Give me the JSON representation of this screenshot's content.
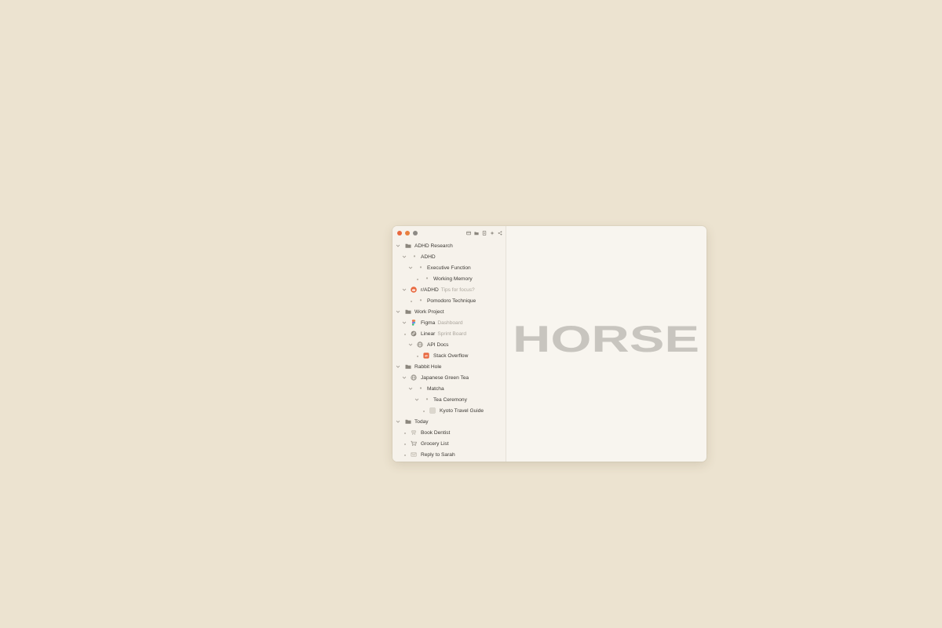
{
  "brand": {
    "wordmark": "HORSE"
  },
  "colors": {
    "background": "#ece3d0",
    "window": "#f8f5ef",
    "accent": "#e8683f",
    "wordmark": "#c8c5bf"
  },
  "toolbar": {
    "buttons": [
      "tab-icon",
      "folder-icon",
      "document-icon",
      "sparkle-icon",
      "share-icon"
    ]
  },
  "tree": {
    "r0": {
      "label": "ADHD Research",
      "icon": "folder-icon"
    },
    "r1": {
      "label": "ADHD",
      "icon": "note-icon"
    },
    "r2": {
      "label": "Executive Function",
      "icon": "note-icon"
    },
    "r3": {
      "label": "Working Memory",
      "icon": "note-icon"
    },
    "r4": {
      "label": "r/ADHD",
      "sub": "Tips for focus?",
      "icon": "reddit-icon"
    },
    "r5": {
      "label": "Pomodoro Technique",
      "icon": "note-icon"
    },
    "r6": {
      "label": "Work Project",
      "icon": "folder-icon"
    },
    "r7": {
      "label": "Figma",
      "sub": "Dashboard",
      "icon": "figma-icon"
    },
    "r8": {
      "label": "Linear",
      "sub": "Sprint Board",
      "icon": "linear-icon"
    },
    "r9": {
      "label": "API Docs",
      "icon": "globe-icon"
    },
    "r10": {
      "label": "Stack Overflow",
      "icon": "stackoverflow-icon"
    },
    "r11": {
      "label": "Rabbit Hole",
      "icon": "folder-icon"
    },
    "r12": {
      "label": "Japanese Green Tea",
      "icon": "globe-icon"
    },
    "r13": {
      "label": "Matcha",
      "icon": "note-icon"
    },
    "r14": {
      "label": "Tea Ceremony",
      "icon": "note-icon"
    },
    "r15": {
      "label": "Kyoto Travel Guide",
      "icon": "page-icon"
    },
    "r16": {
      "label": "Today",
      "icon": "folder-icon"
    },
    "r17": {
      "label": "Book Dentist",
      "icon": "tooth-icon"
    },
    "r18": {
      "label": "Grocery List",
      "icon": "cart-icon"
    },
    "r19": {
      "label": "Reply to Sarah",
      "icon": "mail-icon"
    }
  }
}
